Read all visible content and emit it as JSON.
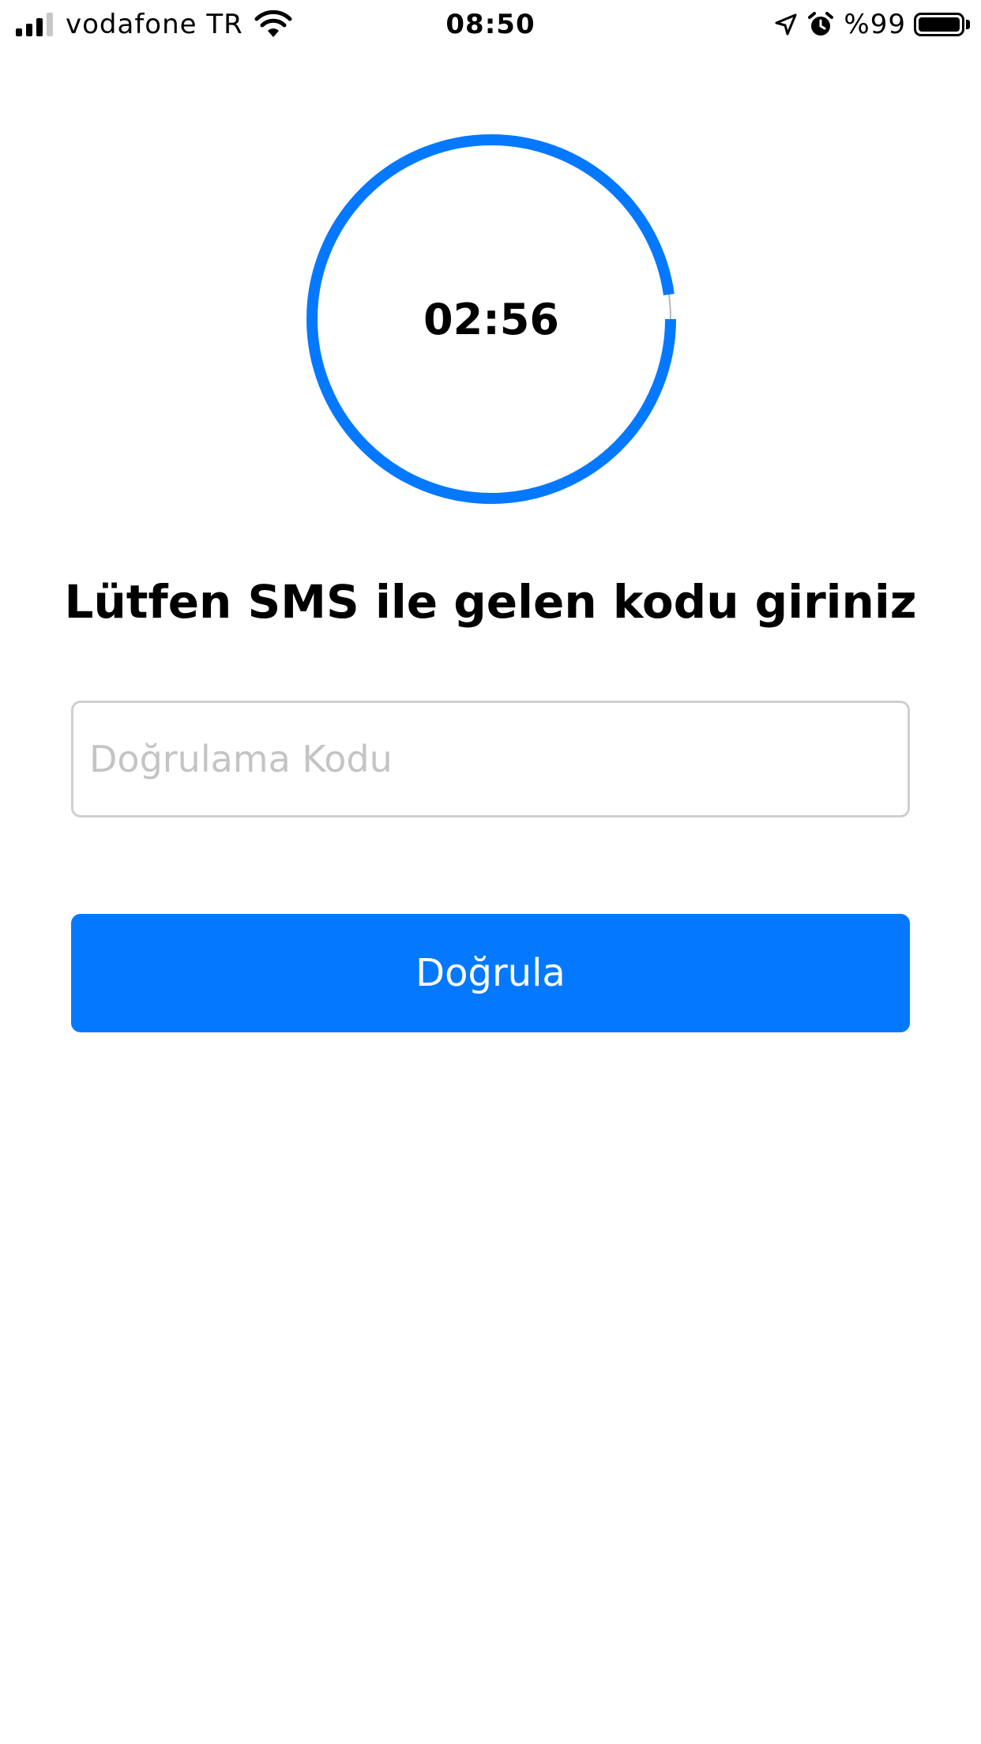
{
  "status_bar": {
    "carrier": "vodafone TR",
    "time": "08:50",
    "battery_percent": "%99",
    "signal_bars_filled": 3,
    "signal_bars_total": 4,
    "icons": [
      "cellular-signal-icon",
      "wifi-icon",
      "location-arrow-icon",
      "alarm-clock-icon",
      "battery-icon"
    ]
  },
  "timer": {
    "remaining": "02:56",
    "progress_fraction": 0.978,
    "ring_color": "#0479ff",
    "track_color": "#b8b8b8"
  },
  "heading": "Lütfen SMS ile gelen kodu giriniz",
  "code_input": {
    "value": "",
    "placeholder": "Doğrulama Kodu"
  },
  "verify_button": {
    "label": "Doğrula",
    "color": "#0479ff"
  }
}
